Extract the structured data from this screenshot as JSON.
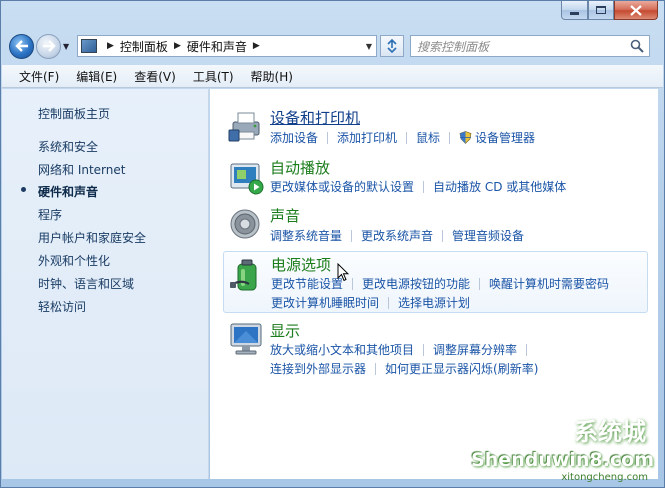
{
  "window": {
    "caption_buttons": [
      "minimize-icon",
      "maximize-icon",
      "close-icon"
    ]
  },
  "address": {
    "breadcrumbs": [
      "控制面板",
      "硬件和声音"
    ],
    "search_placeholder": "搜索控制面板"
  },
  "menu": [
    "文件(F)",
    "编辑(E)",
    "查看(V)",
    "工具(T)",
    "帮助(H)"
  ],
  "sidebar": {
    "items": [
      {
        "label": "控制面板主页",
        "active": false
      },
      {
        "label": "系统和安全",
        "active": false
      },
      {
        "label": "网络和 Internet",
        "active": false
      },
      {
        "label": "硬件和声音",
        "active": true
      },
      {
        "label": "程序",
        "active": false
      },
      {
        "label": "用户帐户和家庭安全",
        "active": false
      },
      {
        "label": "外观和个性化",
        "active": false
      },
      {
        "label": "时钟、语言和区域",
        "active": false
      },
      {
        "label": "轻松访问",
        "active": false
      }
    ]
  },
  "categories": [
    {
      "title": "设备和打印机",
      "icon": "printer-icon",
      "rows": [
        [
          "添加设备",
          "添加打印机",
          "鼠标",
          "设备管理器"
        ]
      ]
    },
    {
      "title": "自动播放",
      "icon": "autoplay-icon",
      "rows": [
        [
          "更改媒体或设备的默认设置",
          "自动播放 CD 或其他媒体"
        ]
      ]
    },
    {
      "title": "声音",
      "icon": "speaker-icon",
      "rows": [
        [
          "调整系统音量",
          "更改系统声音",
          "管理音频设备"
        ]
      ]
    },
    {
      "title": "电源选项",
      "icon": "battery-icon",
      "rows": [
        [
          "更改节能设置",
          "更改电源按钮的功能",
          "唤醒计算机时需要密码"
        ],
        [
          "更改计算机睡眠时间",
          "选择电源计划"
        ]
      ]
    },
    {
      "title": "显示",
      "icon": "monitor-icon",
      "rows": [
        [
          "放大或缩小文本和其他项目",
          "调整屏幕分辨率"
        ],
        [
          "连接到外部显示器",
          "如何更正显示器闪烁(刷新率)"
        ]
      ]
    }
  ],
  "watermark": {
    "text": "Shenduwin8.com",
    "sub": "xitongcheng.com",
    "cn": "系统城"
  }
}
